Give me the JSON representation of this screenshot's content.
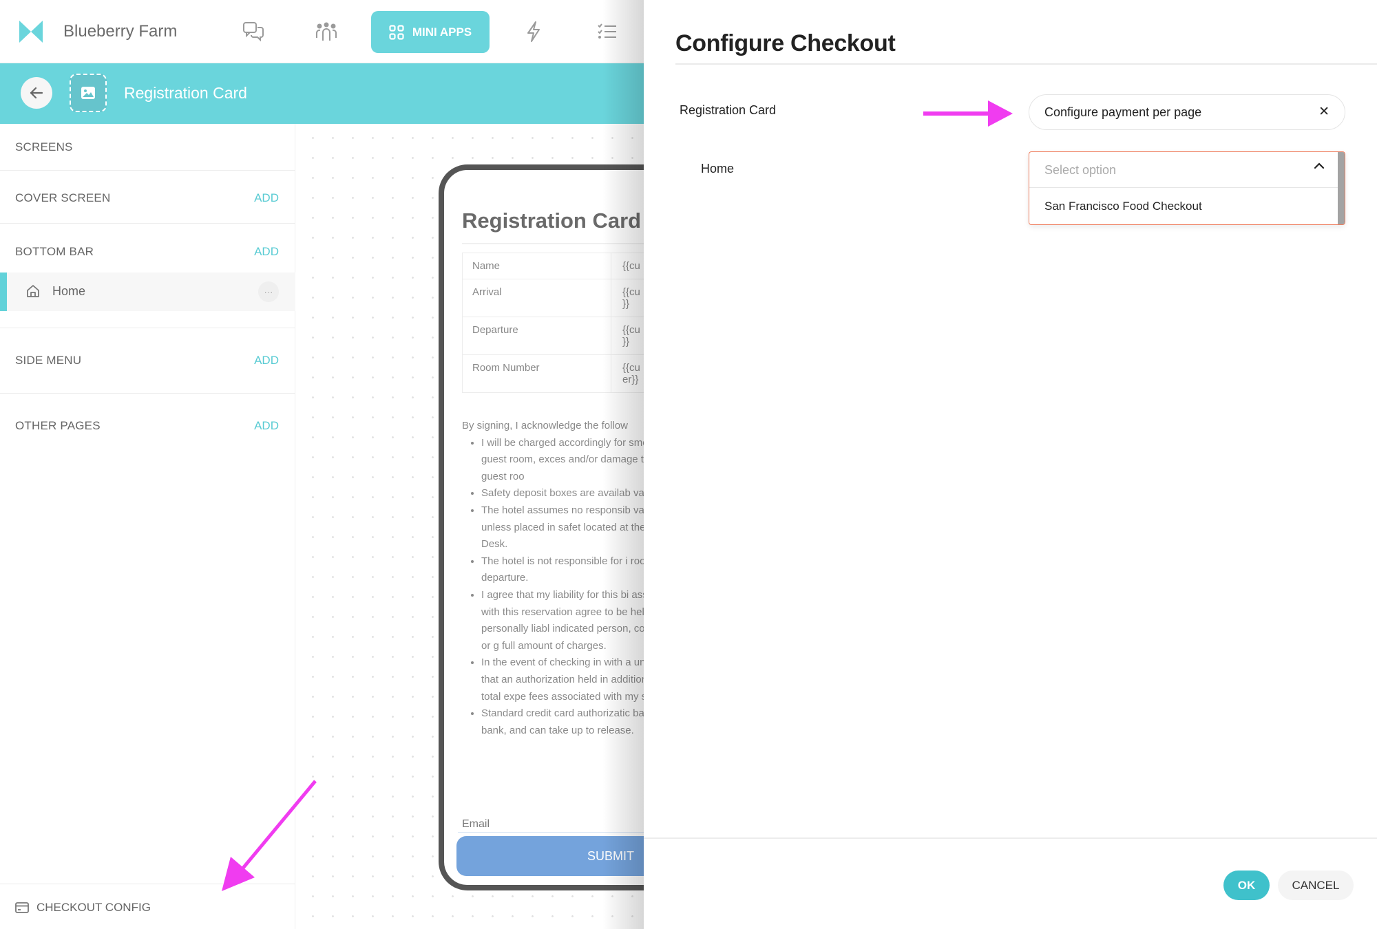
{
  "app": {
    "brand": "Blueberry Farm",
    "nav": {
      "icons": [
        "chat-icon",
        "people-icon",
        "grid-icon",
        "lightning-icon",
        "checklist-icon"
      ],
      "active_label": "MINI APPS"
    }
  },
  "page_header": {
    "title": "Registration Card"
  },
  "sidebar": {
    "title": "SCREENS",
    "add_label": "ADD",
    "sections": [
      {
        "label": "COVER SCREEN"
      },
      {
        "label": "BOTTOM BAR",
        "items": [
          {
            "label": "Home",
            "icon": "home-icon",
            "more": "···"
          }
        ]
      },
      {
        "label": "SIDE MENU"
      },
      {
        "label": "OTHER PAGES"
      }
    ],
    "footer": {
      "label": "CHECKOUT CONFIG",
      "icon": "credit-card-icon"
    }
  },
  "preview": {
    "title": "Registration Card",
    "table": [
      {
        "key": "Name",
        "value": "{{cu"
      },
      {
        "key": "Arrival",
        "value": "{{cu\n}}"
      },
      {
        "key": "Departure",
        "value": "{{cu\n}}"
      },
      {
        "key": "Room Number",
        "value": "{{cu\ner}}"
      }
    ],
    "intro": "By signing, I acknowledge the follow",
    "bullets": [
      "I will be charged accordingly for smoking in a guest room, exces and/or damage to the guest roo",
      "Safety deposit boxes are availab valuables.",
      "The hotel assumes no responsib valuables unless placed in safet located at the Front Desk.",
      "The hotel is not responsible for i rooms after departure.",
      "I agree that my liability for this bi associated with this reservation agree to be held personally liabl indicated person, company, or g full amount of charges.",
      "In the event of checking in with a understand that an authorization held in addition to the total expe fees associated with my stay.",
      "Standard credit card authorizatic bank to bank, and can take up to release."
    ],
    "email_label": "Email",
    "submit_label": "SUBMIT"
  },
  "dialog": {
    "title": "Configure Checkout",
    "rows": [
      {
        "label": "Registration Card",
        "chip_value": "Configure payment per page",
        "clear_label": "✕"
      },
      {
        "label": "Home",
        "select_placeholder": "Select option",
        "options": [
          "San Francisco Food Checkout"
        ]
      }
    ],
    "ok_label": "OK",
    "cancel_label": "CANCEL"
  },
  "colors": {
    "accent": "#6ad5dc",
    "ok_button": "#3fc1cb",
    "submit": "#74a3dc",
    "dropdown_border": "#ef7d5d",
    "annotation_arrow": "#f03cf0"
  }
}
